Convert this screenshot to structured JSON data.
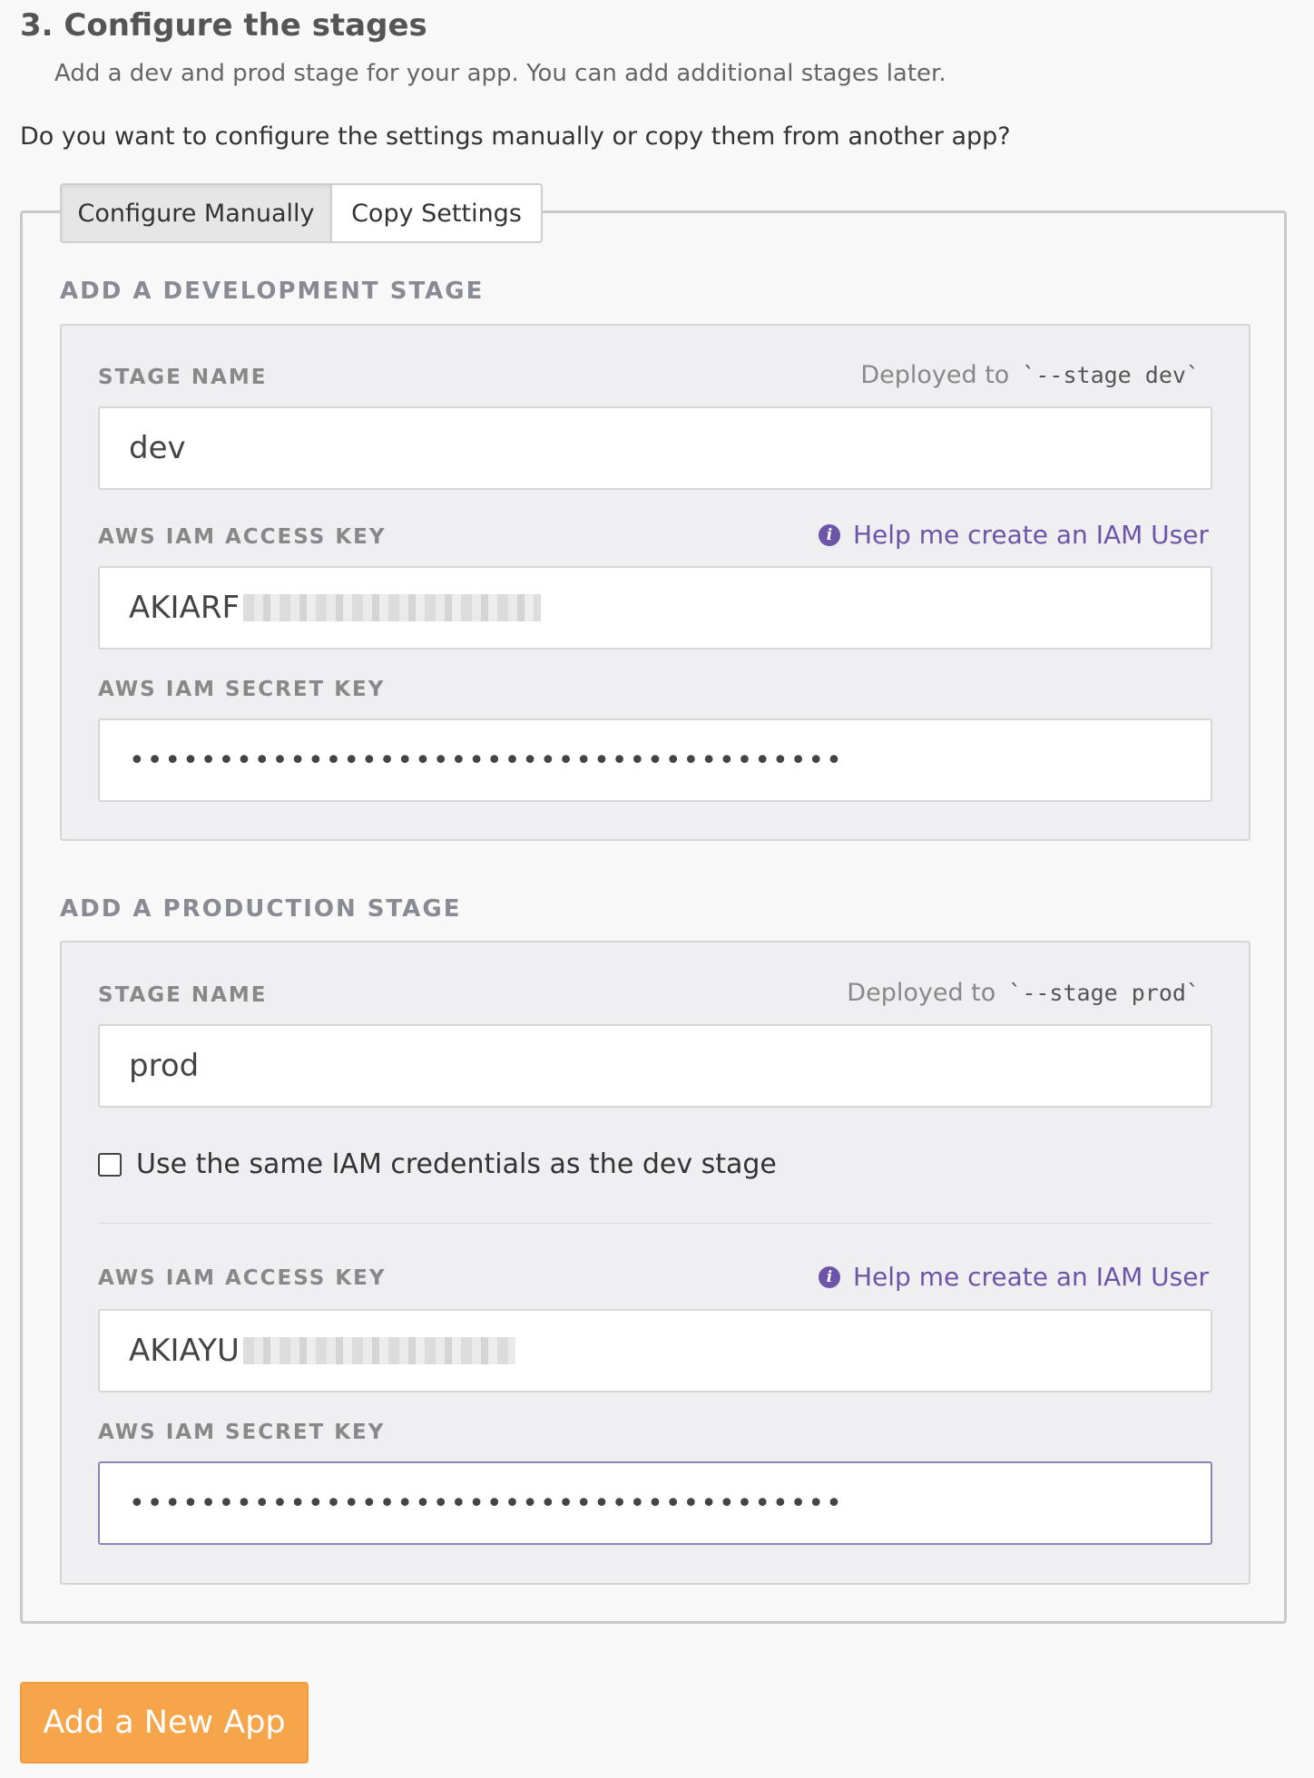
{
  "header": {
    "title": "3. Configure the stages",
    "subtitle": "Add a dev and prod stage for your app. You can add additional stages later.",
    "question": "Do you want to configure the settings manually or copy them from another app?"
  },
  "tabs": [
    {
      "label": "Configure Manually",
      "active": true
    },
    {
      "label": "Copy Settings",
      "active": false
    }
  ],
  "dev": {
    "heading": "ADD A DEVELOPMENT STAGE",
    "stage_label": "STAGE NAME",
    "deployed_prefix": "Deployed to",
    "deployed_code": "`--stage dev`",
    "stage_value": "dev",
    "access_key_label": "AWS IAM ACCESS KEY",
    "help_link": "Help me create an IAM User",
    "access_key_value": "AKIARF",
    "secret_key_label": "AWS IAM SECRET KEY",
    "secret_key_value": "••••••••••••••••••••••••••••••••••••••••"
  },
  "prod": {
    "heading": "ADD A PRODUCTION STAGE",
    "stage_label": "STAGE NAME",
    "deployed_prefix": "Deployed to",
    "deployed_code": "`--stage prod`",
    "stage_value": "prod",
    "checkbox_label": "Use the same IAM credentials as the dev stage",
    "checkbox_checked": false,
    "access_key_label": "AWS IAM ACCESS KEY",
    "help_link": "Help me create an IAM User",
    "access_key_value": "AKIAYU",
    "secret_key_label": "AWS IAM SECRET KEY",
    "secret_key_value": "••••••••••••••••••••••••••••••••••••••••"
  },
  "icons": {
    "help": "info-circle-icon"
  },
  "colors": {
    "accent": "#6c55a8",
    "primary_button": "#f7a54a"
  },
  "actions": {
    "submit_label": "Add a New App"
  }
}
